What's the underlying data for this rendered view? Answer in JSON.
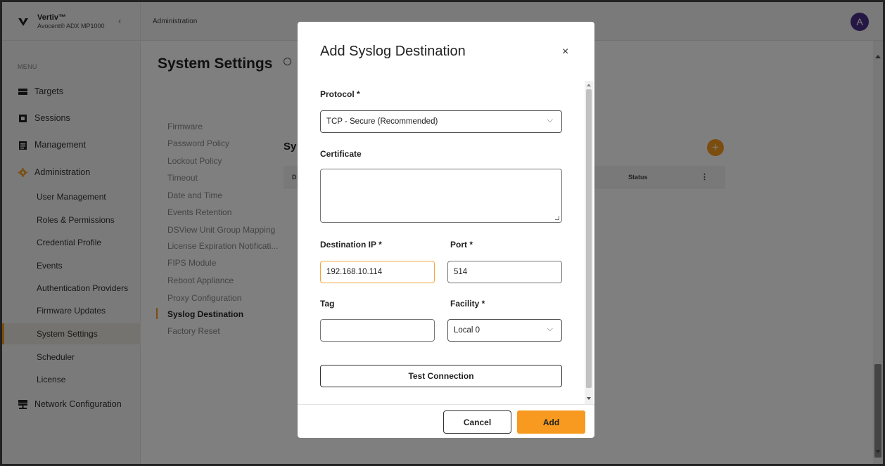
{
  "brand": {
    "name": "Vertiv™",
    "product": "Avocent® ADX MP1000"
  },
  "sidebar": {
    "menu_label": "MENU",
    "items": [
      {
        "label": "Targets",
        "icon": "targets-icon"
      },
      {
        "label": "Sessions",
        "icon": "sessions-icon"
      },
      {
        "label": "Management",
        "icon": "clipboard-icon"
      },
      {
        "label": "Administration",
        "icon": "gear-icon"
      }
    ],
    "admin_subitems": [
      "User Management",
      "Roles & Permissions",
      "Credential Profile",
      "Events",
      "Authentication Providers",
      "Firmware Updates",
      "System Settings",
      "Scheduler",
      "License"
    ],
    "network": {
      "label": "Network Configuration",
      "icon": "network-icon"
    }
  },
  "header": {
    "breadcrumb": "Administration",
    "avatar": "A"
  },
  "main": {
    "title": "System Settings",
    "settings_links": [
      "Firmware",
      "Password Policy",
      "Lockout Policy",
      "Timeout",
      "Date and Time",
      "Events Retention",
      "DSView Unit Group Mapping",
      "License Expiration Notificati...",
      "FIPS Module",
      "Reboot Appliance",
      "Proxy Configuration",
      "Syslog Destination",
      "Factory Reset"
    ],
    "active_link": "Syslog Destination",
    "section_heading": "Sy",
    "table_col_d": "D",
    "table_col_status": "Status",
    "add_label": "+"
  },
  "modal": {
    "title": "Add Syslog Destination",
    "close": "×",
    "protocol_label": "Protocol *",
    "protocol_value": "TCP - Secure (Recommended)",
    "certificate_label": "Certificate",
    "certificate_value": "",
    "dest_ip_label": "Destination IP *",
    "dest_ip_value": "192.168.10.114",
    "port_label": "Port *",
    "port_value": "514",
    "tag_label": "Tag",
    "tag_value": "",
    "facility_label": "Facility *",
    "facility_value": "Local 0",
    "test_label": "Test Connection",
    "cancel_label": "Cancel",
    "add_label": "Add"
  },
  "colors": {
    "accent": "#f79a1f",
    "avatar": "#4b2f86"
  }
}
